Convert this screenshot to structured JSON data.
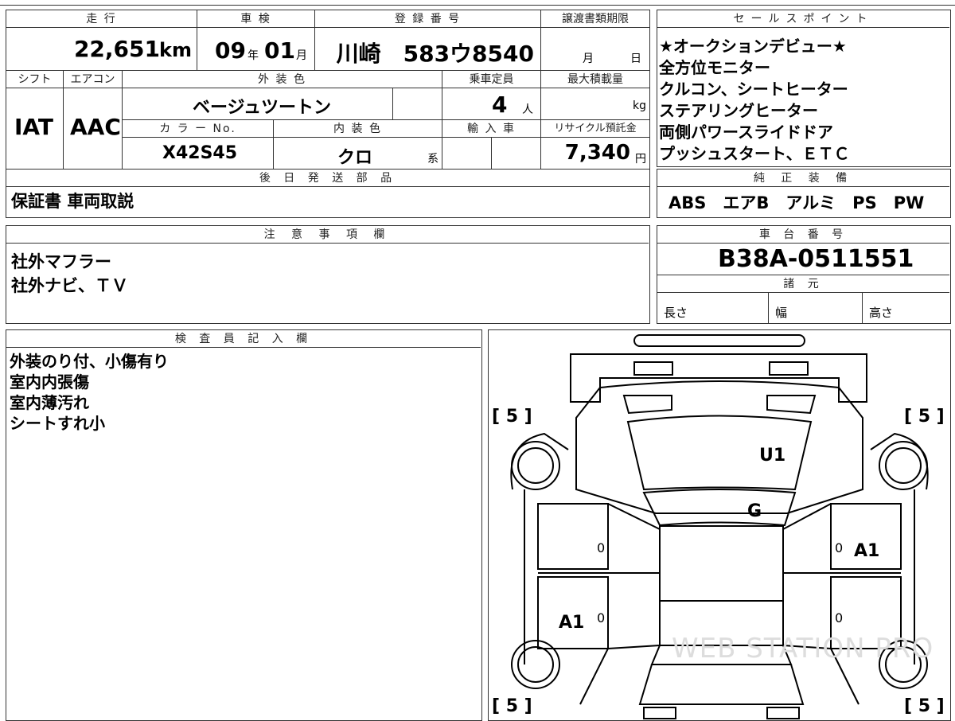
{
  "main": {
    "mileage_label": "走 行",
    "mileage_value": "22,651",
    "mileage_unit": "km",
    "inspection_label": "車 検",
    "inspection_year": "09",
    "year_unit": "年",
    "inspection_month": "01",
    "month_unit": "月",
    "registration_label": "登 録 番 号",
    "registration_value": "川崎　583ウ8540",
    "transfer_label": "譲渡書類期限",
    "transfer_month": "月",
    "transfer_day": "日",
    "shift_label": "シフト",
    "shift_value": "IAT",
    "ac_label": "エアコン",
    "ac_value": "AAC",
    "exterior_label": "外 装 色",
    "exterior_value": "ベージュツートン",
    "capacity_label": "乗車定員",
    "capacity_value": "4",
    "capacity_unit": "人",
    "load_label": "最大積載量",
    "load_unit": "kg",
    "color_no_label": "カ ラ ー No.",
    "color_no_value": "X42S45",
    "interior_label": "内 装 色",
    "interior_value": "クロ",
    "interior_unit": "系",
    "import_label": "輸 入 車",
    "recycle_label": "リサイクル預託金",
    "recycle_value": "7,340",
    "recycle_unit": "円",
    "later_parts_label": "後 日 発 送 部 品",
    "later_parts_value": "保証書 車両取説"
  },
  "sales": {
    "label": "セールスポイント",
    "lines": [
      "★オークションデビュー★",
      "全方位モニター",
      "クルコン、シートヒーター",
      "ステアリングヒーター",
      "両側パワースライドドア",
      "プッシュスタート、ＥＴＣ"
    ]
  },
  "equipment": {
    "label": "純 正 装 備",
    "value": "ABS　エアB　アルミ　PS　PW"
  },
  "notes": {
    "label": "注 意 事 項 欄",
    "lines": [
      "社外マフラー",
      "社外ナビ、ＴＶ"
    ]
  },
  "chassis": {
    "label": "車 台 番 号",
    "value": "B38A-0511551",
    "spec_label": "諸 元",
    "length_label": "長さ",
    "width_label": "幅",
    "height_label": "高さ"
  },
  "inspector": {
    "label": "検 査 員 記 入 欄",
    "lines": [
      "外装のり付、小傷有り",
      "室内内張傷",
      "室内薄汚れ",
      "シートすれ小"
    ]
  },
  "diagram": {
    "tire_fl": "[ 5 ]",
    "tire_fr": "[ 5 ]",
    "tire_rl": "[ 5 ]",
    "tire_rr": "[ 5 ]",
    "mark_u1": "U1",
    "mark_g": "G",
    "mark_a1_right": "A1",
    "mark_a1_left": "A1",
    "zero_1": "0",
    "zero_2": "0",
    "zero_3": "0",
    "zero_4": "0",
    "watermark": "WEB STATION PRO"
  }
}
